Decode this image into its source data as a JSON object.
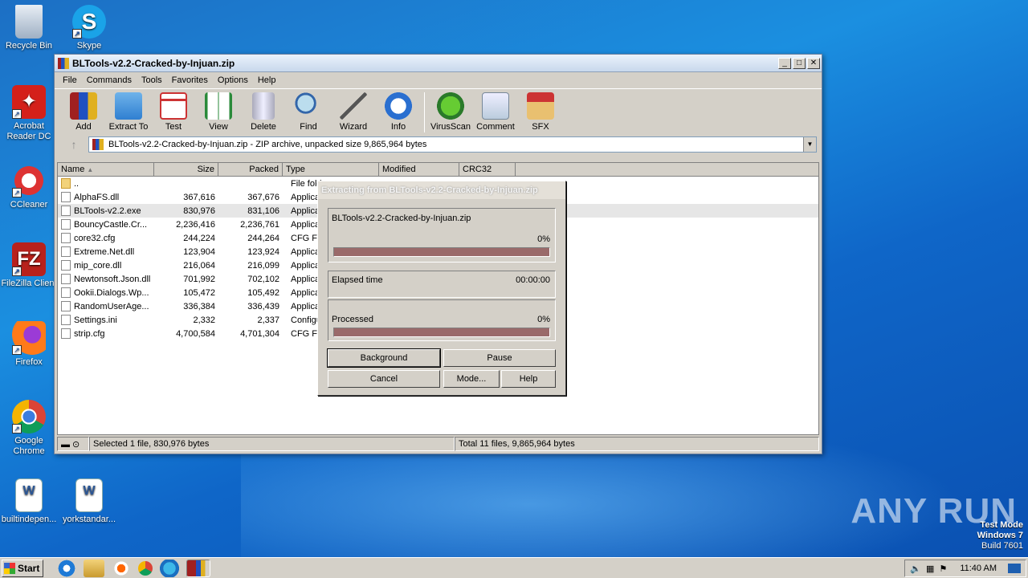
{
  "desktop": {
    "icons": [
      {
        "label": "Recycle Bin"
      },
      {
        "label": "Skype"
      },
      {
        "label": "Acrobat Reader DC"
      },
      {
        "label": "CCleaner"
      },
      {
        "label": "FileZilla Client"
      },
      {
        "label": "Firefox"
      },
      {
        "label": "Google Chrome"
      },
      {
        "label": "builtindepen..."
      },
      {
        "label": "yorkstandar..."
      }
    ]
  },
  "window": {
    "title": "BLTools-v2.2-Cracked-by-Injuan.zip",
    "menu": [
      "File",
      "Commands",
      "Tools",
      "Favorites",
      "Options",
      "Help"
    ],
    "toolbar": [
      "Add",
      "Extract To",
      "Test",
      "View",
      "Delete",
      "Find",
      "Wizard",
      "Info",
      "VirusScan",
      "Comment",
      "SFX"
    ],
    "address": "BLTools-v2.2-Cracked-by-Injuan.zip - ZIP archive, unpacked size 9,865,964 bytes",
    "columns": [
      "Name",
      "Size",
      "Packed",
      "Type",
      "Modified",
      "CRC32"
    ],
    "files": [
      {
        "name": "..",
        "size": "",
        "packed": "",
        "type": "File fold"
      },
      {
        "name": "AlphaFS.dll",
        "size": "367,616",
        "packed": "367,676",
        "type": "Applicat"
      },
      {
        "name": "BLTools-v2.2.exe",
        "size": "830,976",
        "packed": "831,106",
        "type": "Applicat"
      },
      {
        "name": "BouncyCastle.Cr...",
        "size": "2,236,416",
        "packed": "2,236,761",
        "type": "Applicat"
      },
      {
        "name": "core32.cfg",
        "size": "244,224",
        "packed": "244,264",
        "type": "CFG File"
      },
      {
        "name": "Extreme.Net.dll",
        "size": "123,904",
        "packed": "123,924",
        "type": "Applicat"
      },
      {
        "name": "mip_core.dll",
        "size": "216,064",
        "packed": "216,099",
        "type": "Applicat"
      },
      {
        "name": "Newtonsoft.Json.dll",
        "size": "701,992",
        "packed": "702,102",
        "type": "Applicat"
      },
      {
        "name": "Ookii.Dialogs.Wp...",
        "size": "105,472",
        "packed": "105,492",
        "type": "Applicat"
      },
      {
        "name": "RandomUserAge...",
        "size": "336,384",
        "packed": "336,439",
        "type": "Applicat"
      },
      {
        "name": "Settings.ini",
        "size": "2,332",
        "packed": "2,337",
        "type": "Configu"
      },
      {
        "name": "strip.cfg",
        "size": "4,700,584",
        "packed": "4,701,304",
        "type": "CFG File"
      }
    ],
    "status_left": "Selected 1 file, 830,976 bytes",
    "status_right": "Total 11 files, 9,865,964 bytes"
  },
  "dialog": {
    "title": "Extracting from BLTools-v2.2-Cracked-by-Injuan.zip",
    "archive": "BLTools-v2.2-Cracked-by-Injuan.zip",
    "percent1": "0%",
    "elapsed_label": "Elapsed time",
    "elapsed_value": "00:00:00",
    "processed_label": "Processed",
    "percent2": "0%",
    "buttons": {
      "background": "Background",
      "pause": "Pause",
      "cancel": "Cancel",
      "mode": "Mode...",
      "help": "Help"
    }
  },
  "taskbar": {
    "start": "Start",
    "clock": "11:40 AM"
  },
  "watermark": "ANY RUN",
  "testmode": {
    "line1": "Test Mode",
    "line2": "Windows 7",
    "line3": "Build 7601"
  }
}
